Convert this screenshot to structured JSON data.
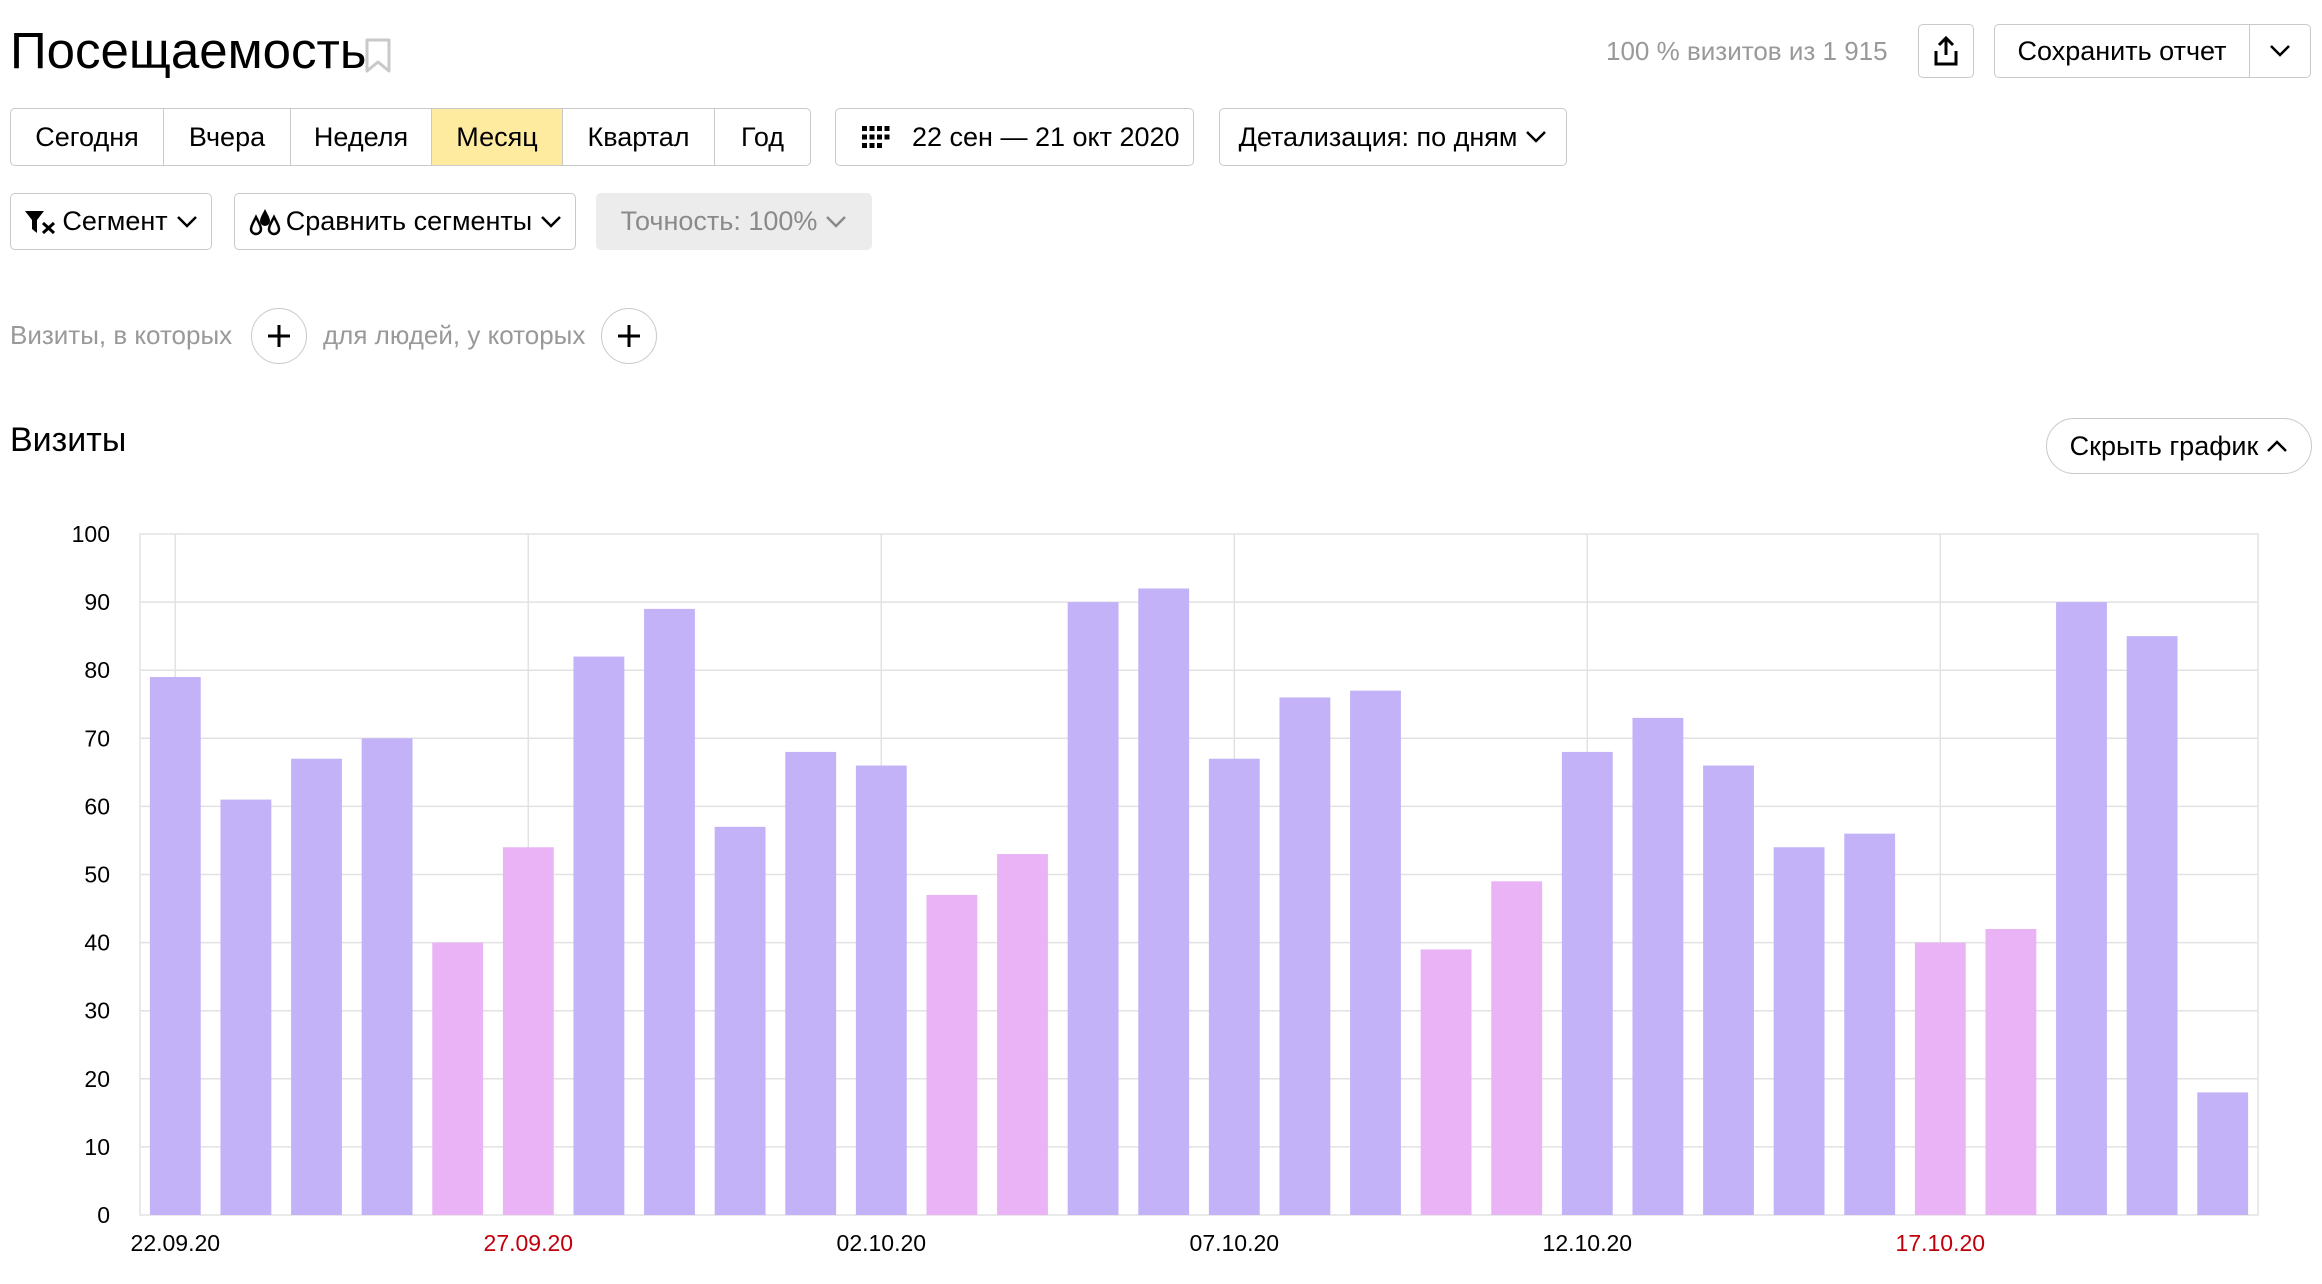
{
  "header": {
    "title": "Посещаемость",
    "visits_info": "100 % визитов из 1 915",
    "save_label": "Сохранить отчет"
  },
  "periods": [
    "Сегодня",
    "Вчера",
    "Неделя",
    "Месяц",
    "Квартал",
    "Год"
  ],
  "active_period": "Месяц",
  "date_range": "22 сен — 21 окт 2020",
  "detail_label": "Детализация: по дням",
  "segment_label": "Сегмент",
  "compare_label": "Сравнить сегменты",
  "accuracy_label": "Точность: 100%",
  "filters": {
    "visits_label": "Визиты, в которых",
    "people_label": "для людей, у которых"
  },
  "section_title": "Визиты",
  "hide_chart_label": "Скрыть график",
  "icons": [
    "bookmark-icon",
    "share-icon",
    "chevron-down-icon",
    "calendar-icon",
    "segment-filter-icon",
    "compare-drops-icon",
    "plus-icon",
    "chevron-up-icon"
  ],
  "colors": {
    "weekday_bar": "#c3b2f8",
    "weekend_bar": "#e9b3f6",
    "active_period_bg": "#ffeba0",
    "weekend_label": "#c0000c"
  },
  "chart_data": {
    "type": "bar",
    "title": "",
    "xlabel": "",
    "ylabel": "",
    "ylim": [
      0,
      100
    ],
    "yticks": [
      0,
      10,
      20,
      30,
      40,
      50,
      60,
      70,
      80,
      90,
      100
    ],
    "grid": true,
    "x_tick_labels": [
      {
        "label": "22.09.20",
        "index": 0,
        "weekend": false
      },
      {
        "label": "27.09.20",
        "index": 5,
        "weekend": true
      },
      {
        "label": "02.10.20",
        "index": 10,
        "weekend": false
      },
      {
        "label": "07.10.20",
        "index": 15,
        "weekend": false
      },
      {
        "label": "12.10.20",
        "index": 20,
        "weekend": false
      },
      {
        "label": "17.10.20",
        "index": 25,
        "weekend": true
      }
    ],
    "categories": [
      "22.09.20",
      "23.09.20",
      "24.09.20",
      "25.09.20",
      "26.09.20",
      "27.09.20",
      "28.09.20",
      "29.09.20",
      "30.09.20",
      "01.10.20",
      "02.10.20",
      "03.10.20",
      "04.10.20",
      "05.10.20",
      "06.10.20",
      "07.10.20",
      "08.10.20",
      "09.10.20",
      "10.10.20",
      "11.10.20",
      "12.10.20",
      "13.10.20",
      "14.10.20",
      "15.10.20",
      "16.10.20",
      "17.10.20",
      "18.10.20",
      "19.10.20",
      "20.10.20",
      "21.10.20"
    ],
    "values": [
      79,
      61,
      67,
      70,
      40,
      54,
      82,
      89,
      57,
      68,
      66,
      47,
      53,
      90,
      92,
      67,
      76,
      77,
      39,
      49,
      68,
      73,
      66,
      54,
      56,
      40,
      42,
      90,
      85,
      18
    ],
    "weekend": [
      false,
      false,
      false,
      false,
      true,
      true,
      false,
      false,
      false,
      false,
      false,
      true,
      true,
      false,
      false,
      false,
      false,
      false,
      true,
      true,
      false,
      false,
      false,
      false,
      false,
      true,
      true,
      false,
      false,
      false
    ]
  }
}
